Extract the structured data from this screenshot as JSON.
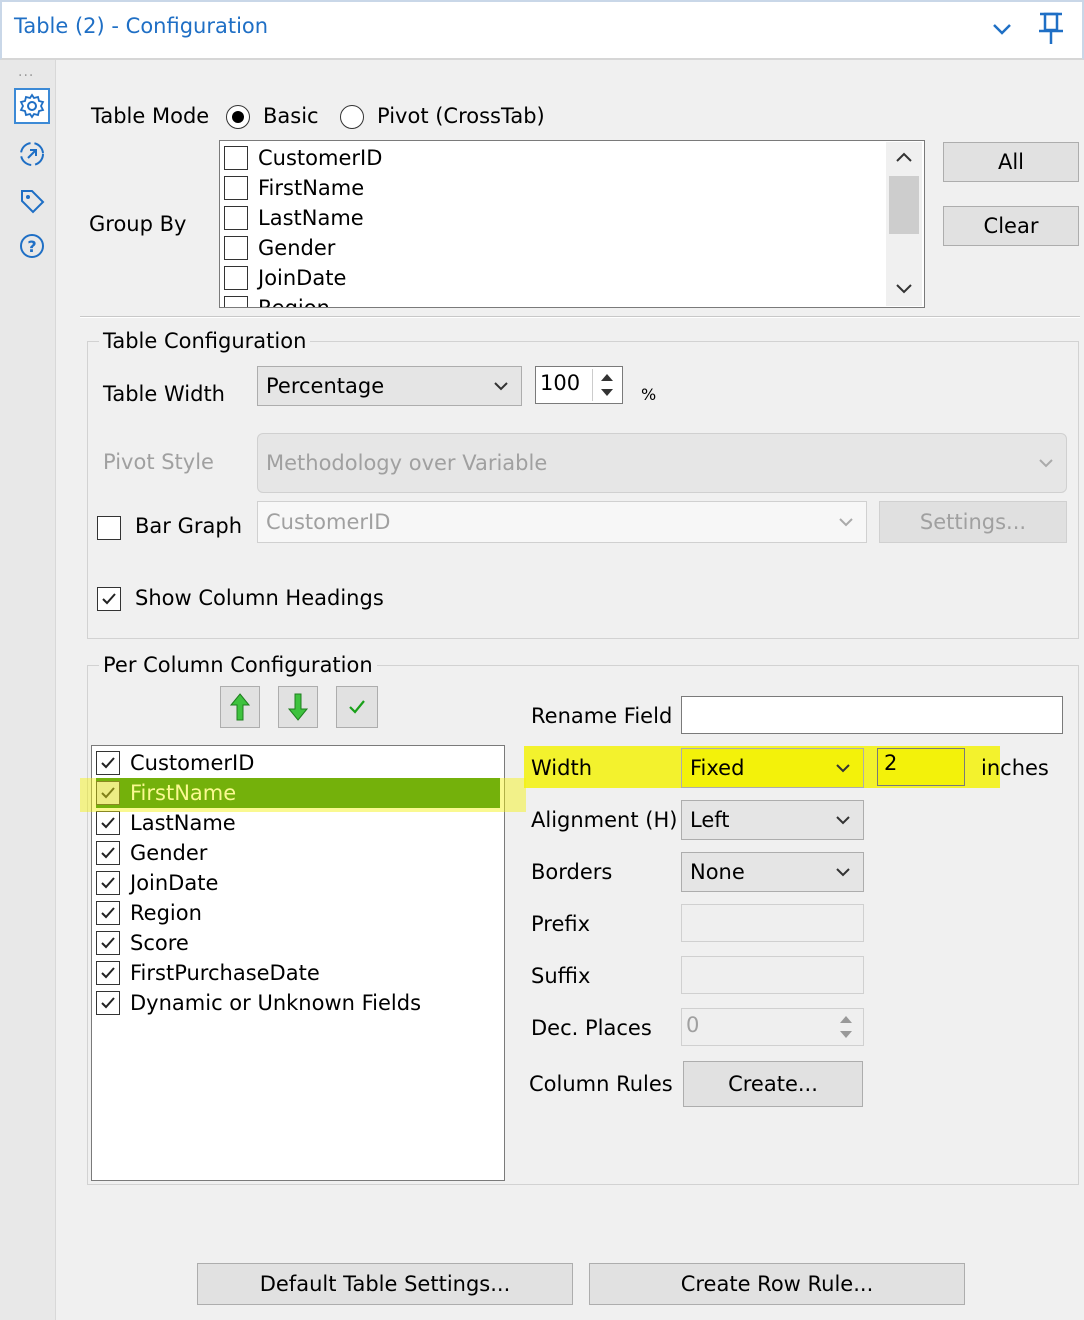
{
  "window": {
    "title": "Table (2) - Configuration"
  },
  "rail": {
    "dots": "...",
    "icons": [
      "gear-icon",
      "connection-icon",
      "tag-icon",
      "help-icon"
    ]
  },
  "table_mode": {
    "label": "Table Mode",
    "options": [
      {
        "label": "Basic",
        "selected": true
      },
      {
        "label": "Pivot (CrossTab)",
        "selected": false
      }
    ]
  },
  "group_by": {
    "label": "Group By",
    "items": [
      "CustomerID",
      "FirstName",
      "LastName",
      "Gender",
      "JoinDate",
      "Region"
    ],
    "all_button": "All",
    "clear_button": "Clear"
  },
  "table_config": {
    "title": "Table Configuration",
    "table_width_label": "Table Width",
    "table_width_value": "Percentage",
    "table_width_number": "100",
    "table_width_unit": "%",
    "pivot_style_label": "Pivot Style",
    "pivot_style_value": "Methodology over Variable",
    "bar_graph_label": "Bar Graph",
    "bar_graph_checked": false,
    "bar_graph_field": "CustomerID",
    "settings_button": "Settings...",
    "show_headings_label": "Show Column Headings",
    "show_headings_checked": true
  },
  "per_column": {
    "title": "Per Column Configuration",
    "columns": [
      {
        "label": "CustomerID",
        "checked": true,
        "selected": false
      },
      {
        "label": "FirstName",
        "checked": true,
        "selected": true
      },
      {
        "label": "LastName",
        "checked": true,
        "selected": false
      },
      {
        "label": "Gender",
        "checked": true,
        "selected": false
      },
      {
        "label": "JoinDate",
        "checked": true,
        "selected": false
      },
      {
        "label": "Region",
        "checked": true,
        "selected": false
      },
      {
        "label": "Score",
        "checked": true,
        "selected": false
      },
      {
        "label": "FirstPurchaseDate",
        "checked": true,
        "selected": false
      },
      {
        "label": "Dynamic or Unknown Fields",
        "checked": true,
        "selected": false
      }
    ],
    "rename_field_label": "Rename Field",
    "rename_field_value": "",
    "width_label": "Width",
    "width_mode": "Fixed",
    "width_value": "2",
    "width_unit": "inches",
    "alignment_label": "Alignment (H)",
    "alignment_value": "Left",
    "borders_label": "Borders",
    "borders_value": "None",
    "prefix_label": "Prefix",
    "suffix_label": "Suffix",
    "dec_places_label": "Dec. Places",
    "dec_places_value": "0",
    "column_rules_label": "Column Rules",
    "create_button": "Create..."
  },
  "footer": {
    "default_settings_button": "Default Table Settings...",
    "create_row_rule_button": "Create Row Rule..."
  },
  "colors": {
    "accent": "#1f6fc5",
    "selection": "#0b7d0b",
    "highlight": "#f3f20a"
  }
}
